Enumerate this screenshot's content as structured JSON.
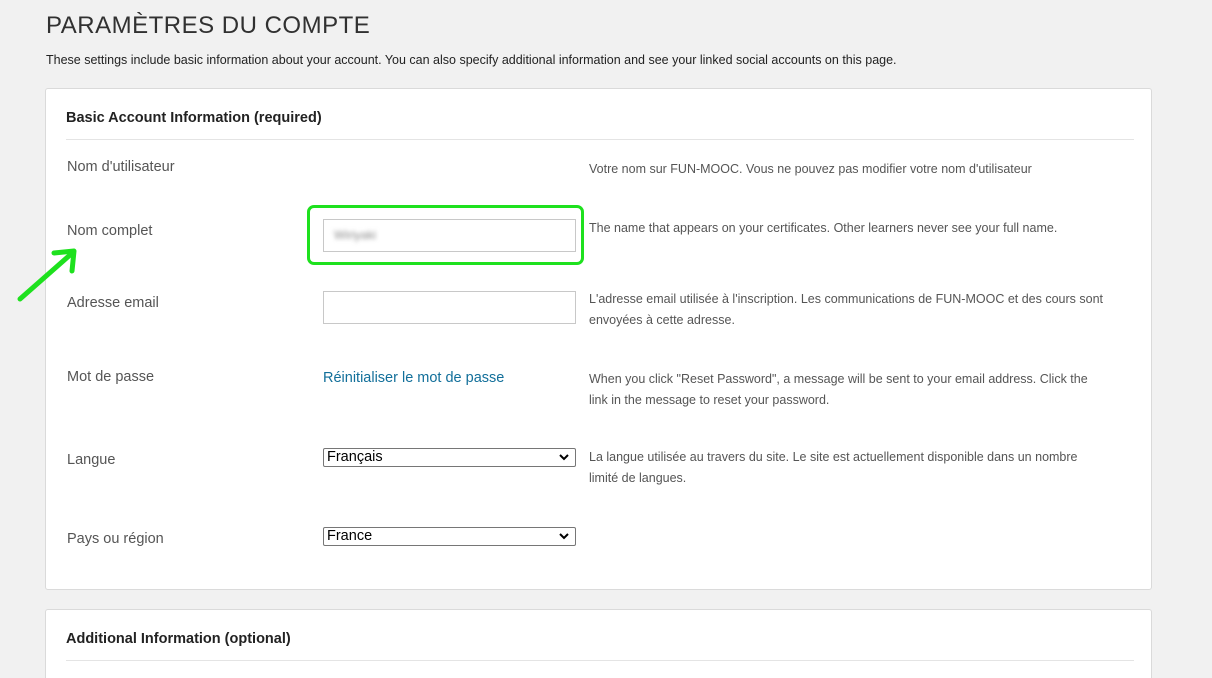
{
  "page": {
    "title": "PARAMÈTRES DU COMPTE",
    "intro": "These settings include basic information about your account. You can also specify additional information and see your linked social accounts on this page."
  },
  "basic": {
    "title": "Basic Account Information (required)",
    "username": {
      "label": "Nom d'utilisateur",
      "help": "Votre nom sur FUN-MOOC. Vous ne pouvez pas modifier votre nom d'utilisateur"
    },
    "fullname": {
      "label": "Nom complet",
      "value": "Wiriyaki",
      "help": "The name that appears on your certificates. Other learners never see your full name."
    },
    "email": {
      "label": "Adresse email",
      "value": "",
      "help": "L'adresse email utilisée à l'inscription. Les communications de FUN-MOOC et des cours sont envoyées à cette adresse."
    },
    "password": {
      "label": "Mot de passe",
      "link": "Réinitialiser le mot de passe",
      "help": "When you click \"Reset Password\", a message will be sent to your email address. Click the link in the message to reset your password."
    },
    "language": {
      "label": "Langue",
      "selected": "Français",
      "help": "La langue utilisée au travers du site. Le site est actuellement disponible dans un nombre limité de langues."
    },
    "country": {
      "label": "Pays ou région",
      "selected": "France"
    }
  },
  "additional": {
    "title": "Additional Information (optional)"
  },
  "annotation": {
    "color": "#1ee11e",
    "icon": "arrow-icon"
  }
}
